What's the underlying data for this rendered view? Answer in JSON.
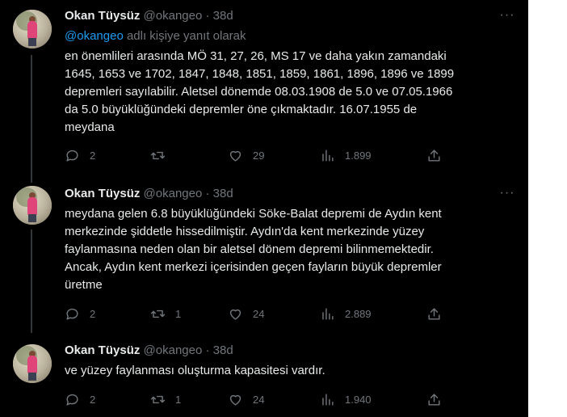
{
  "tweets": [
    {
      "name": "Okan Tüysüz",
      "handle": "@okangeo",
      "separator": "·",
      "time": "38d",
      "reply_mention": "@okangeo",
      "reply_suffix": " adlı kişiye yanıt olarak",
      "lines": [
        "en önemlileri arasında MÖ 31, 27, 26, MS 17 ve daha yakın zamandaki",
        "1645, 1653 ve 1702, 1847, 1848, 1851, 1859, 1861, 1896, 1896 ve 1899",
        "depremleri sayılabilir. Aletsel dönemde 08.03.1908 de 5.0 ve 07.05.1966",
        "da 5.0 büyüklüğündeki depremler öne çıkmaktadır. 16.07.1955 de",
        "meydana"
      ],
      "replies": "2",
      "retweets": "",
      "likes": "29",
      "views": "1.899"
    },
    {
      "name": "Okan Tüysüz",
      "handle": "@okangeo",
      "separator": "·",
      "time": "38d",
      "lines": [
        "meydana gelen 6.8 büyüklüğündeki Söke-Balat depremi de Aydın kent",
        "merkezinde şiddetle hissedilmiştir. Aydın'da kent merkezinde yüzey",
        "faylanmasına neden olan bir aletsel dönem depremi bilinmemektedir.",
        "Ancak, Aydın kent merkezi içerisinden geçen fayların büyük depremler",
        "üretme"
      ],
      "replies": "2",
      "retweets": "1",
      "likes": "24",
      "views": "2.889"
    },
    {
      "name": "Okan Tüysüz",
      "handle": "@okangeo",
      "separator": "·",
      "time": "38d",
      "lines": [
        "ve yüzey faylanması oluşturma kapasitesi vardır."
      ],
      "replies": "2",
      "retweets": "1",
      "likes": "24",
      "views": "1.940"
    }
  ],
  "icons": {
    "reply": "speech-bubble-icon",
    "retweet": "retweet-arrows-icon",
    "like": "heart-icon",
    "views": "bar-chart-icon",
    "share": "upload-arrow-icon",
    "more": "three-dots-icon"
  },
  "colors": {
    "background": "#000000",
    "text": "#e7e9ea",
    "muted": "#71767b",
    "accent": "#1d9bf0"
  }
}
